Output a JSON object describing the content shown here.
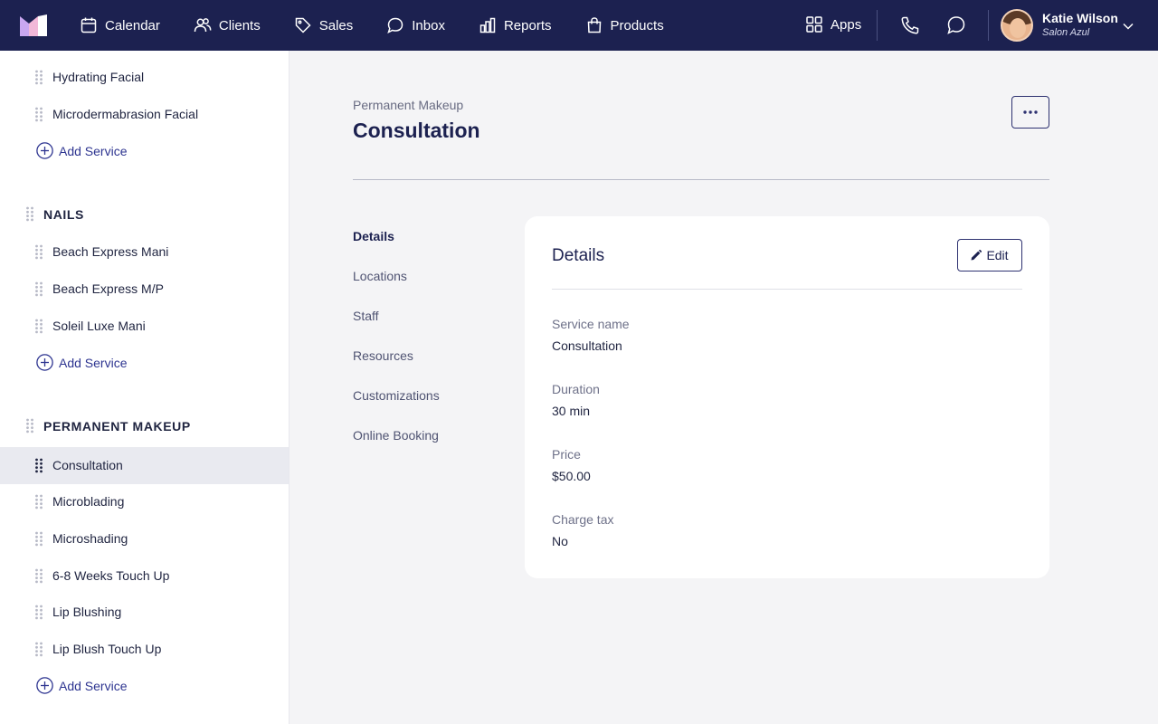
{
  "nav": {
    "items": [
      {
        "label": "Calendar",
        "icon": "calendar-icon"
      },
      {
        "label": "Clients",
        "icon": "clients-icon"
      },
      {
        "label": "Sales",
        "icon": "tag-icon"
      },
      {
        "label": "Inbox",
        "icon": "inbox-icon"
      },
      {
        "label": "Reports",
        "icon": "bar-chart-icon"
      },
      {
        "label": "Products",
        "icon": "shopping-bag-icon"
      }
    ],
    "apps_label": "Apps",
    "user": {
      "name": "Katie Wilson",
      "business": "Salon Azul"
    }
  },
  "sidebar": {
    "groups": [
      {
        "category": "",
        "services": [
          "Hydrating Facial",
          "Microdermabrasion Facial"
        ],
        "add_label": "Add Service"
      },
      {
        "category": "NAILS",
        "services": [
          "Beach Express Mani",
          "Beach Express M/P",
          "Soleil Luxe Mani"
        ],
        "add_label": "Add Service"
      },
      {
        "category": "PERMANENT MAKEUP",
        "services": [
          "Consultation",
          "Microblading",
          "Microshading",
          "6-8 Weeks Touch Up",
          "Lip Blushing",
          "Lip Blush Touch Up"
        ],
        "add_label": "Add Service"
      }
    ],
    "active_service": "Consultation"
  },
  "main": {
    "breadcrumb": "Permanent Makeup",
    "title": "Consultation",
    "subnav": [
      "Details",
      "Locations",
      "Staff",
      "Resources",
      "Customizations",
      "Online Booking"
    ],
    "active_tab": "Details"
  },
  "card": {
    "title": "Details",
    "edit_label": "Edit",
    "fields": [
      {
        "label": "Service name",
        "value": "Consultation"
      },
      {
        "label": "Duration",
        "value": "30 min"
      },
      {
        "label": "Price",
        "value": "$50.00"
      },
      {
        "label": "Charge tax",
        "value": "No"
      }
    ]
  },
  "colors": {
    "nav_bg": "#1c2150",
    "accent": "#2d3490",
    "active_row": "#e9eaf0"
  }
}
